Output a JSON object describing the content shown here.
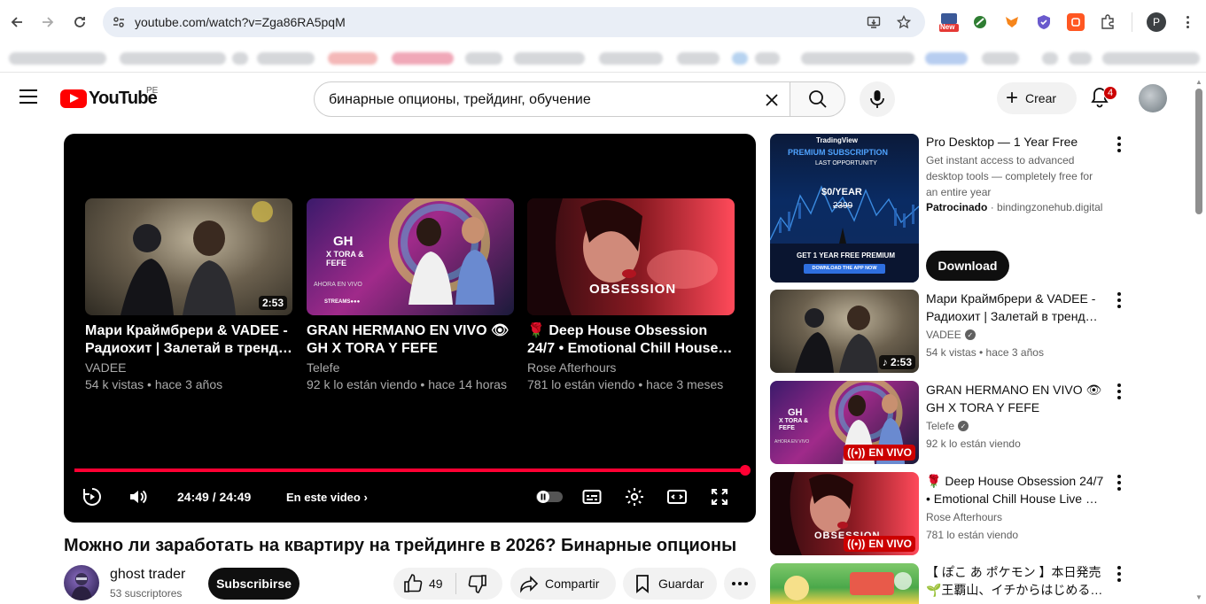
{
  "browser": {
    "url": "youtube.com/watch?v=Zga86RA5pqM",
    "ext_new_badge": "New",
    "profile_initial": "P"
  },
  "header": {
    "logo_text": "YouTube",
    "region": "PE",
    "search_value": "бинарные опционы, трейдинг, обучение",
    "create_label": "Crear",
    "notifications_count": "4"
  },
  "player": {
    "time": "24:49 / 24:49",
    "chapter_label": "En este video",
    "progress": 1.0,
    "end_cards": [
      {
        "title": "Мари Краймбрери & VADEE - Радиохит | Залетай в тренд…",
        "channel": "VADEE",
        "meta": "54 k vistas • hace 3 años",
        "duration": "2:53"
      },
      {
        "title": "GRAN HERMANO EN VIVO 👁 GH X TORA Y FEFE",
        "channel": "Telefe",
        "meta": "92 k lo están viendo • hace 14 horas"
      },
      {
        "title": "🌹 Deep House Obsession 24/7 • Emotional Chill House…",
        "channel": "Rose Afterhours",
        "meta": "781 lo están viendo • hace 3 meses"
      }
    ],
    "thumb_texts": {
      "gh_logo": "GH",
      "gh_sub": "X TORA & FEFE",
      "gh_live": "AHORA EN VIVO",
      "gh_streams": "STREAMS●●●",
      "obsession": "OBSESSION"
    }
  },
  "video": {
    "title": "Можно ли заработать на квартиру на трейдинге в 2026? Бинарные опционы",
    "channel": "ghost trader",
    "subscribers": "53 suscriptores",
    "subscribe_label": "Subscribirse",
    "likes": "49",
    "share_label": "Compartir",
    "save_label": "Guardar"
  },
  "sidebar": {
    "ad": {
      "title": "Pro Desktop — 1 Year Free",
      "description": "Get instant access to advanced desktop tools — completely free for an entire year",
      "sponsored_label": "Patrocinado",
      "domain": "bindingzonehub.digital",
      "download_label": "Download",
      "thumb_brand": "TradingView",
      "thumb_premium": "PREMIUM SUBSCRIPTION",
      "thumb_last": "LAST OPPORTUNITY",
      "thumb_price": "$0/YEAR",
      "thumb_old_price": "2399",
      "thumb_cta": "GET 1 YEAR FREE PREMIUM",
      "thumb_btn": "DOWNLOAD THE APP NOW"
    },
    "items": [
      {
        "title": "Мари Краймбрери & VADEE - Радиохит | Залетай в тренд…",
        "channel": "VADEE",
        "meta": "54 k vistas • hace 3 años",
        "badge": "2:53"
      },
      {
        "title": "GRAN HERMANO EN VIVO 👁 GH X TORA Y FEFE",
        "channel": "Telefe",
        "meta": "92 k lo están viendo",
        "badge": "EN VIVO"
      },
      {
        "title": "🌹 Deep House Obsession 24/7 • Emotional Chill House Live …",
        "channel": "Rose Afterhours",
        "meta": "781 lo están viendo",
        "badge": "EN VIVO"
      },
      {
        "title": "【 ぽこ あ ポケモン 】本日発売🌱王覇山、イチからはじめる…",
        "channel": "",
        "meta": ""
      }
    ]
  },
  "colors": {
    "accent_red": "#ff0033",
    "live_red": "#cc0000"
  }
}
